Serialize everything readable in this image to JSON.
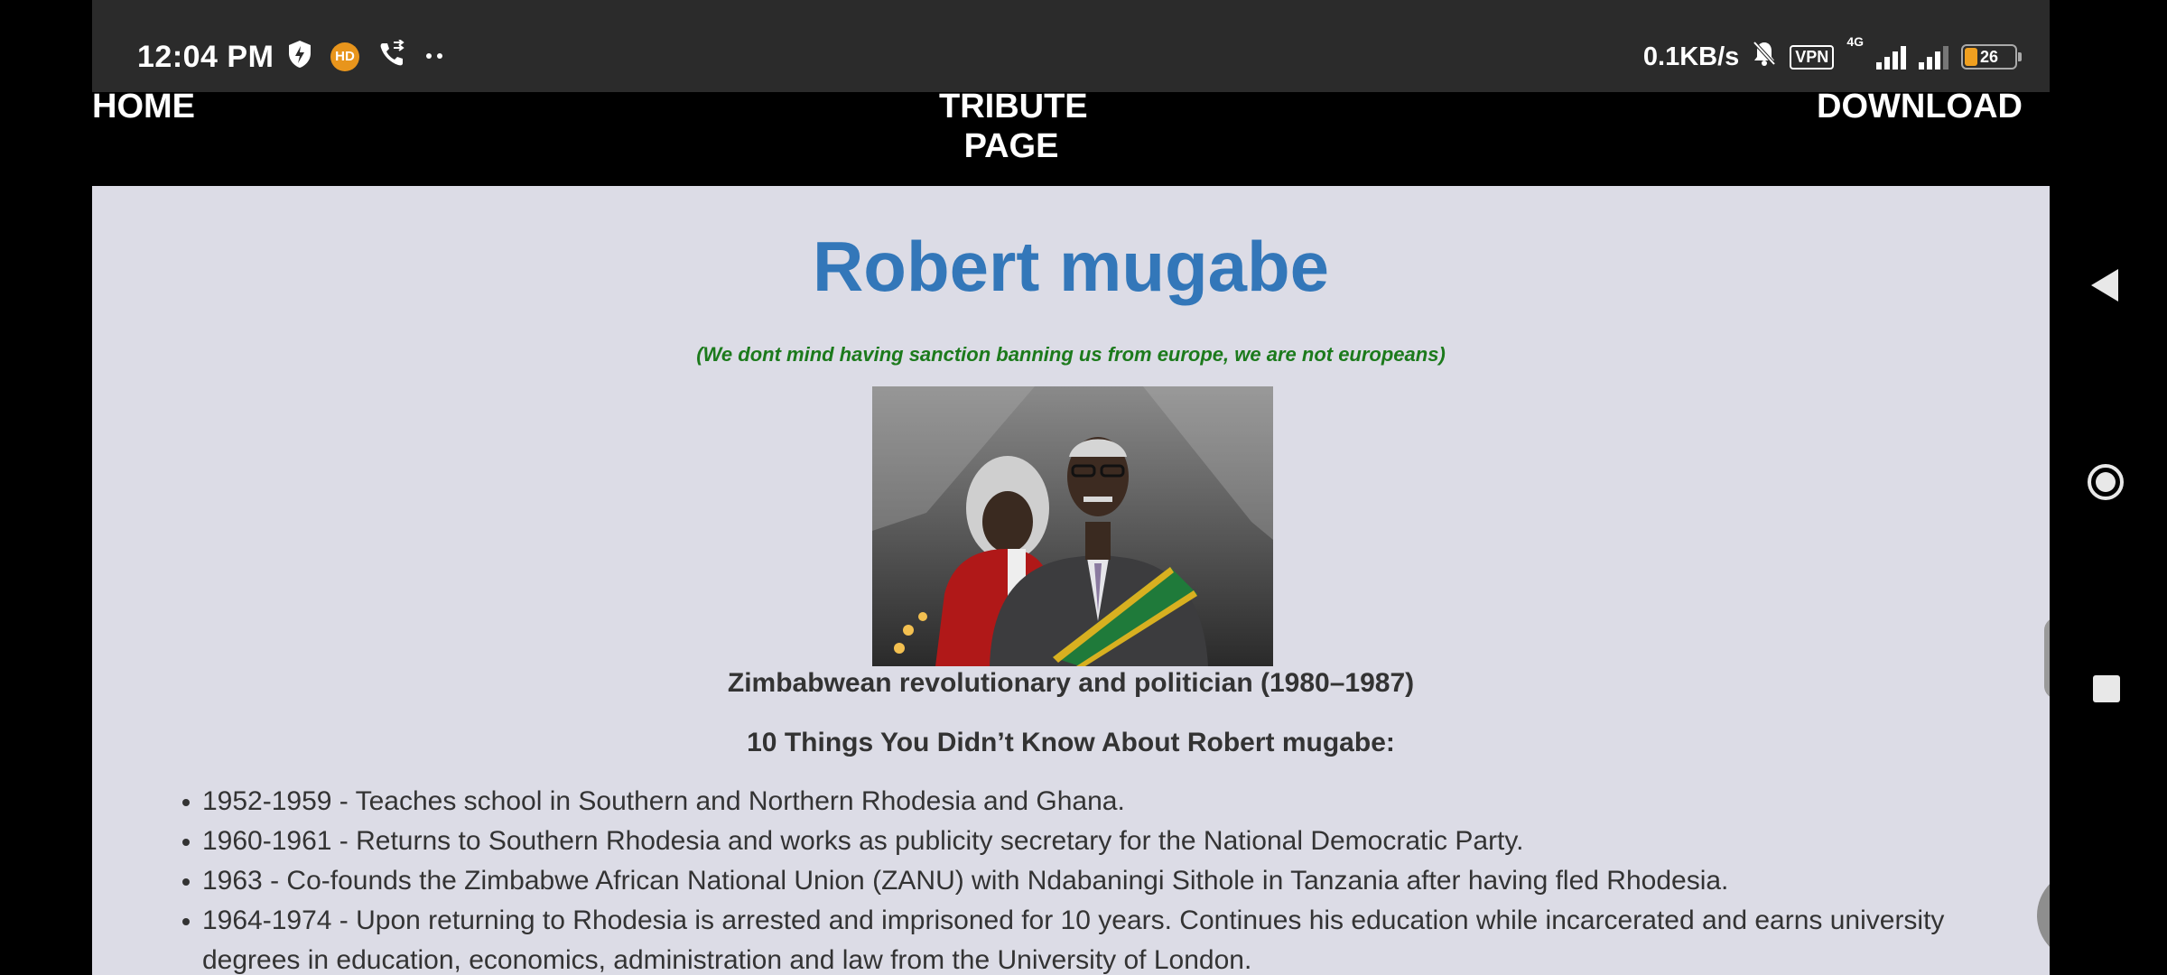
{
  "status_bar": {
    "time": "12:04 PM",
    "left_icons": [
      "shield-bolt-icon",
      "hd-badge-icon",
      "call-forward-icon",
      "more-dots-icon"
    ],
    "hd_label": "HD",
    "net_speed": "0.1KB/s",
    "vpn_label": "VPN",
    "network_type": "4G",
    "battery_level": "26"
  },
  "nav": {
    "home": "HOME",
    "tribute_line1": "TRIBUTE",
    "tribute_line2": "PAGE",
    "download": "DOWNLOAD"
  },
  "main": {
    "title": "Robert mugabe",
    "quote": "(We dont mind having sanction banning us from europe, we are not europeans)",
    "caption": "Zimbabwean revolutionary and politician (1980–1987)",
    "list_heading": "10 Things You Didn’t Know About Robert mugabe:",
    "items": [
      "1952-1959 - Teaches school in Southern and Northern Rhodesia and Ghana.",
      "1960-1961 - Returns to Southern Rhodesia and works as publicity secretary for the National Democratic Party.",
      "1963 - Co-founds the Zimbabwe African National Union (ZANU) with Ndabaningi Sithole in Tanzania after having fled Rhodesia.",
      "1964-1974 - Upon returning to Rhodesia is arrested and imprisoned for 10 years. Continues his education while incarcerated and earns university degrees in education, economics, administration and law from the University of London."
    ]
  },
  "colors": {
    "title": "#3377b9",
    "quote": "#1c7a1c",
    "page_bg": "#dcdce6",
    "navbar_bg": "#000000",
    "statusbar_bg": "#2b2b2b"
  },
  "overlay_buttons": [
    "tools-icon",
    "collapse-arrows-icon"
  ],
  "system_nav": [
    "back-icon",
    "home-icon",
    "recents-icon"
  ]
}
